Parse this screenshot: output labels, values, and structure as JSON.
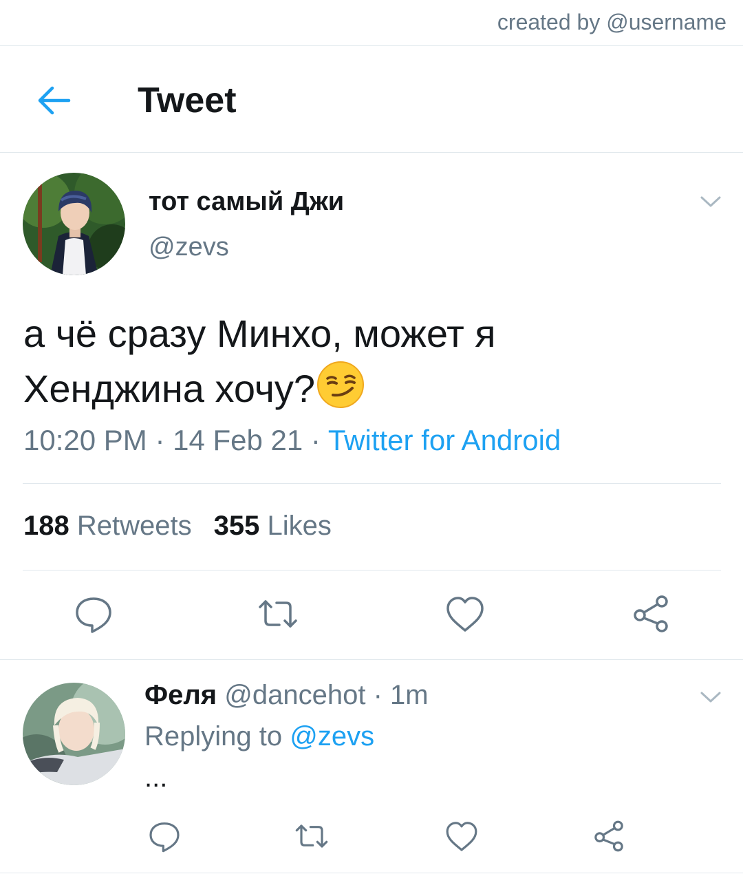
{
  "credit": "created by @username",
  "header": {
    "title": "Tweet",
    "back_icon": "arrow-left-icon"
  },
  "tweet": {
    "display_name": "тот самый Джи",
    "handle": "@zevs",
    "text_line1": "а чё сразу Минхо, может я",
    "text_line2": "Хенджина хочу?",
    "emoji": "smirking-face-emoji",
    "time": "10:20 PM",
    "date": "14 Feb 21",
    "source": "Twitter for Android",
    "separator": " · ",
    "retweets_count": "188",
    "retweets_label": "Retweets",
    "likes_count": "355",
    "likes_label": "Likes"
  },
  "reply": {
    "display_name": "Феля",
    "handle": "@dancehot",
    "time": "1m",
    "separator": " · ",
    "replying_prefix": "Replying to ",
    "replying_to": "@zevs",
    "text": "..."
  },
  "colors": {
    "accent": "#1da1f2",
    "muted": "#657786",
    "divider": "#e1e8ed",
    "text": "#14171a"
  },
  "actions": [
    "reply-icon",
    "retweet-icon",
    "like-icon",
    "share-icon"
  ]
}
